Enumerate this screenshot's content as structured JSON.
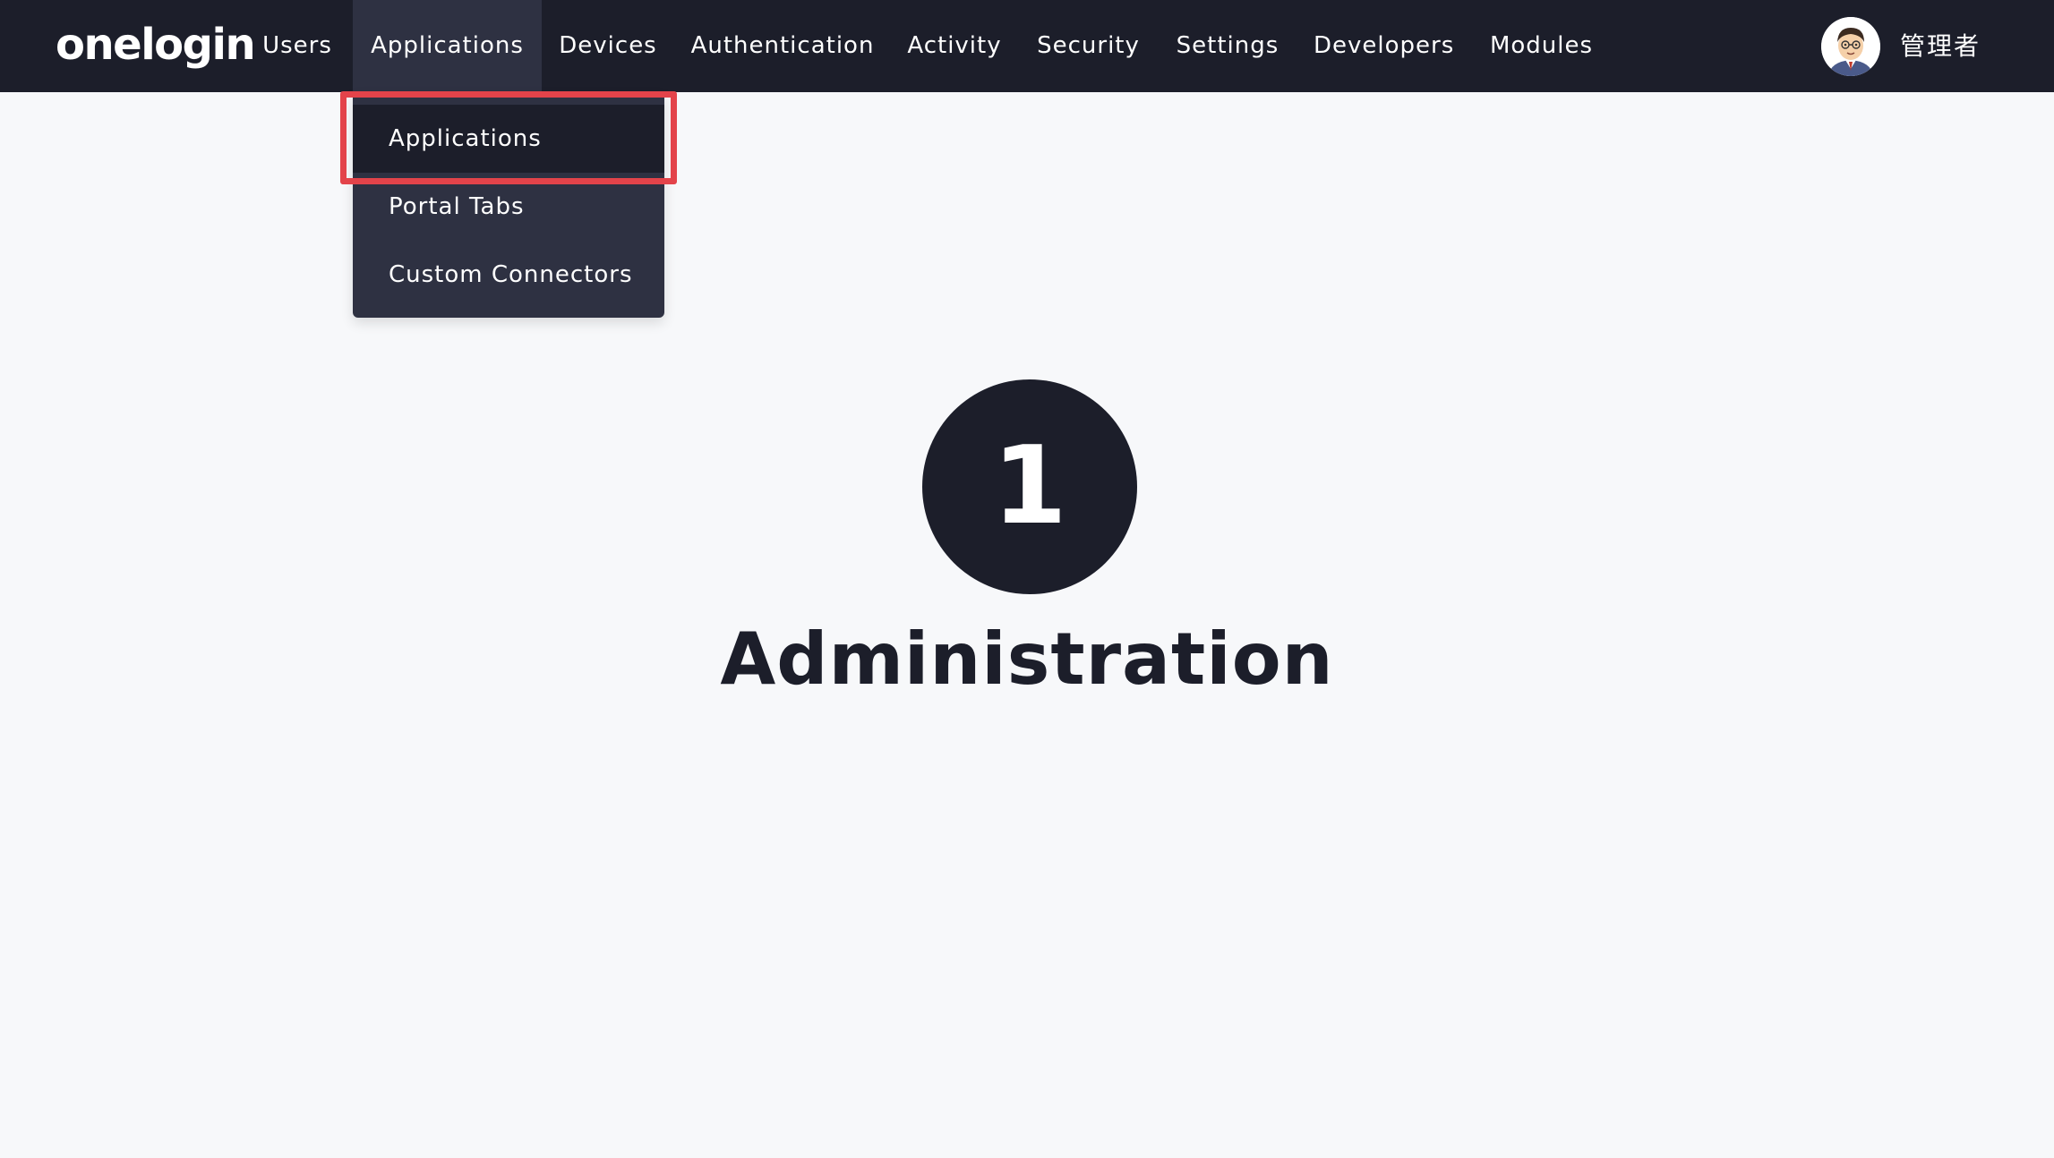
{
  "header": {
    "logo_text": "onelogin",
    "nav": [
      {
        "label": "Users"
      },
      {
        "label": "Applications",
        "active": true
      },
      {
        "label": "Devices"
      },
      {
        "label": "Authentication"
      },
      {
        "label": "Activity"
      },
      {
        "label": "Security"
      },
      {
        "label": "Settings"
      },
      {
        "label": "Developers"
      },
      {
        "label": "Modules"
      }
    ],
    "user": {
      "name": "管理者",
      "avatar_icon": "user-avatar-icon"
    }
  },
  "dropdown": {
    "items": [
      {
        "label": "Applications",
        "selected": true
      },
      {
        "label": "Portal Tabs"
      },
      {
        "label": "Custom Connectors"
      }
    ]
  },
  "main": {
    "step_number": "1",
    "heading": "Administration"
  },
  "colors": {
    "topbar": "#1c1e2a",
    "active_nav": "#2e3142",
    "dropdown_bg": "#2e3142",
    "highlight": "#e3434a",
    "page_bg": "#f7f8fa",
    "heading": "#1c1e2a"
  }
}
